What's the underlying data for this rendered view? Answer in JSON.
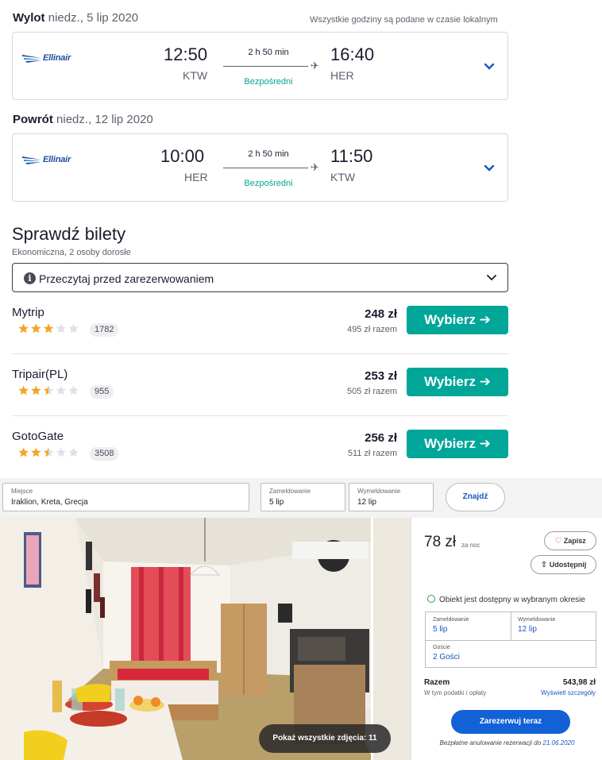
{
  "outbound": {
    "title": "Wylot",
    "date": "niedz., 5 lip 2020",
    "tz_note": "Wszystkie godziny są podane w czasie lokalnym",
    "airline": "Ellinair",
    "dep_time": "12:50",
    "dep_code": "KTW",
    "duration": "2 h 50 min",
    "stops": "Bezpośredni",
    "arr_time": "16:40",
    "arr_code": "HER"
  },
  "return": {
    "title": "Powrót",
    "date": "niedz., 12 lip 2020",
    "airline": "Ellinair",
    "dep_time": "10:00",
    "dep_code": "HER",
    "duration": "2 h 50 min",
    "stops": "Bezpośredni",
    "arr_time": "11:50",
    "arr_code": "KTW"
  },
  "tickets": {
    "heading": "Sprawdź bilety",
    "subheading": "Ekonomiczna, 2 osoby dorosłe",
    "notice": "Przeczytaj przed zarezerwowaniem",
    "offers": [
      {
        "name": "Mytrip",
        "rating": 3,
        "reviews": "1782",
        "price": "248 zł",
        "total": "495 zł razem",
        "button": "Wybierz ➔"
      },
      {
        "name": "Tripair(PL)",
        "rating": 2.5,
        "reviews": "955",
        "price": "253 zł",
        "total": "505 zł razem",
        "button": "Wybierz ➔"
      },
      {
        "name": "GotoGate",
        "rating": 2.5,
        "reviews": "3508",
        "price": "256 zł",
        "total": "511 zł razem",
        "button": "Wybierz ➔"
      }
    ]
  },
  "hotel_search": {
    "place_label": "Miejsce",
    "place_value": "Iraklion, Kreta, Grecja",
    "checkin_label": "Zameldowanie",
    "checkin_value": "5 lip",
    "checkout_label": "Wymeldowanie",
    "checkout_value": "12 lip",
    "find_button": "Znajdź"
  },
  "photo": {
    "show_all": "Pokaż wszystkie zdjęcia: 11"
  },
  "booking": {
    "price": "78 zł",
    "per_night": "za noc",
    "save": "Zapisz",
    "share": "Udostępnij",
    "availability": "Obiekt jest dostępny w wybranym okresie",
    "checkin_label": "Zameldowanie",
    "checkin_value": "5 lip",
    "checkout_label": "Wymeldowanie",
    "checkout_value": "12 lip",
    "guests_label": "Goście",
    "guests_value": "2 Gości",
    "total_label": "Razem",
    "total_value": "543,98 zł",
    "total_sub": "W tym podatki i opłaty",
    "details_link": "Wyświetl szczegóły",
    "book_button": "Zarezerwuj teraz",
    "cancel_text": "Bezpłatne anulowanie rezerwacji do",
    "cancel_date": "21.06.2020"
  },
  "colors": {
    "teal": "#00a698",
    "blue": "#1261d6",
    "star": "#f5a623"
  }
}
